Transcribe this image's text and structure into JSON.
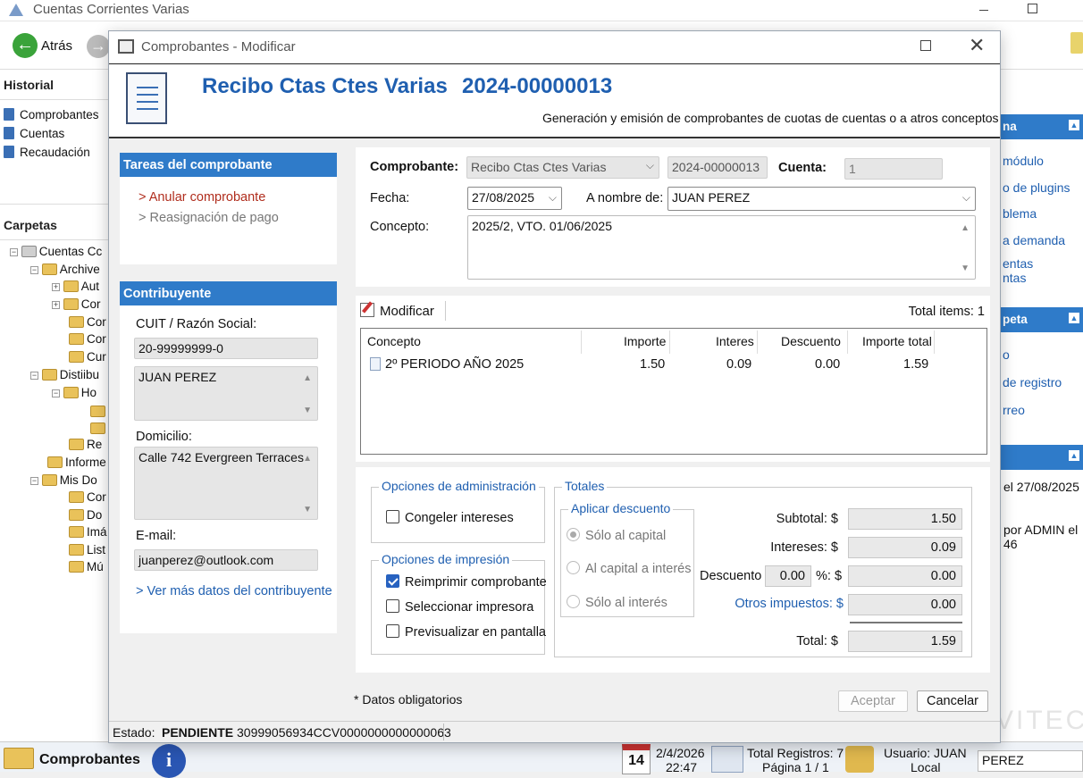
{
  "app": {
    "title": "Cuentas Corrientes Varias",
    "back_label": "Atrás",
    "historial_header": "Historial",
    "historial_items": [
      "Comprobantes",
      "Cuentas",
      "Recaudación"
    ],
    "carpetas_header": "Carpetas",
    "tree": {
      "root": "Cuentas Cc",
      "archive": "Archive",
      "aut": "Aut",
      "cor1": "Cor",
      "cor2": "Cor",
      "cor3": "Cor",
      "cur": "Cur",
      "distiibu": "Distiibu",
      "hoj": "Ho",
      "re": "Re",
      "informe": "Informe",
      "misdo": "Mis Do",
      "cor4": "Cor",
      "doc": "Do",
      "ima": "Imá",
      "list": "List",
      "mu": "Mú"
    },
    "right_panel": {
      "head1": "na",
      "link1": "módulo",
      "link2": "o de plugins",
      "link3": "blema",
      "link4": "a demanda",
      "link5a": "entas",
      "link5b": "ntas",
      "head2": "peta",
      "link6": "o",
      "link7": "de registro",
      "link8": "rreo",
      "info1": "el 27/08/2025",
      "info2a": "por ADMIN el",
      "info2b": "46",
      "watermark": "VITEC"
    },
    "status": {
      "module": "Comprobantes",
      "cal_day": "14",
      "date": "2/4/2026",
      "time": "22:47",
      "total_registros": "Total Registros: 7",
      "pagina": "Página 1 / 1",
      "usuario": "Usuario: JUAN",
      "local": "Local",
      "user_field": "PEREZ"
    }
  },
  "dialog": {
    "title": "Comprobantes - Modificar",
    "heading_name": "Recibo Ctas Ctes Varias",
    "heading_number": "2024-00000013",
    "subtitle": "Generación y emisión de comprobantes de cuotas de cuentas o a atros conceptos",
    "tareas": {
      "header": "Tareas del comprobante",
      "items": [
        "> Anular comprobante",
        "> Reasignación de pago"
      ]
    },
    "contribuyente": {
      "header": "Contribuyente",
      "cuit_label": "CUIT / Razón Social:",
      "cuit_value": "20-99999999-0",
      "razon_value": "JUAN PEREZ",
      "domicilio_label": "Domicilio:",
      "domicilio_value": "Calle 742 Evergreen Terraces",
      "email_label": "E-mail:",
      "email_value": "juanperez@outlook.com",
      "more_link": "> Ver más datos del contribuyente"
    },
    "form": {
      "comprobante_label": "Comprobante:",
      "comprobante_value": "Recibo Ctas Ctes Varias",
      "numero_value": "2024-00000013",
      "cuenta_label": "Cuenta:",
      "cuenta_value": "1",
      "fecha_label": "Fecha:",
      "fecha_value": "27/08/2025",
      "nombre_label": "A nombre de:",
      "nombre_value": "JUAN PEREZ",
      "concepto_label": "Concepto:",
      "concepto_value": "2025/2, VTO. 01/06/2025"
    },
    "items": {
      "modificar_label": "Modificar",
      "total_items": "Total items: 1",
      "columns": [
        "Concepto",
        "Importe",
        "Interes",
        "Descuento",
        "Importe total"
      ],
      "rows": [
        {
          "concepto": "2º PERIODO AÑO 2025",
          "importe": "1.50",
          "interes": "0.09",
          "descuento": "0.00",
          "importe_total": "1.59"
        }
      ]
    },
    "opciones_admin": {
      "title": "Opciones de administración",
      "congelar_label": "Congeler intereses",
      "congelar_checked": false
    },
    "opciones_impresion": {
      "title": "Opciones de impresión",
      "reimprimir_label": "Reimprimir comprobante",
      "reimprimir_checked": true,
      "seleccionar_label": "Seleccionar impresora",
      "previsualizar_label": "Previsualizar en pantalla"
    },
    "totales": {
      "title": "Totales",
      "descuento_group": "Aplicar descuento",
      "radio_capital": "Sólo al capital",
      "radio_capital_interes": "Al capital a interés",
      "radio_interes": "Sólo al interés",
      "subtotal_label": "Subtotal: $",
      "subtotal_value": "1.50",
      "intereses_label": "Intereses: $",
      "intereses_value": "0.09",
      "descuento_label": "Descuento",
      "descuento_pct": "0.00",
      "pct_label": "%: $",
      "descuento_value": "0.00",
      "otros_label": "Otros impuestos: $",
      "otros_value": "0.00",
      "total_label": "Total: $",
      "total_value": "1.59"
    },
    "datos_obligatorios": "* Datos obligatorios",
    "aceptar": "Aceptar",
    "cancelar": "Cancelar",
    "estado_label": "Estado:",
    "estado_value": "PENDIENTE",
    "barcode": "30999056934CCV0000000000000063"
  },
  "colors": {
    "accent": "#2f7bc9",
    "title_blue": "#1f5fb0",
    "link_red": "#b02d1d"
  }
}
